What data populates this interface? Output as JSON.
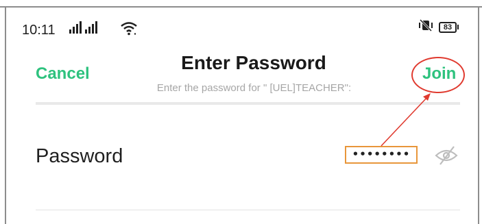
{
  "status_bar": {
    "time": "10:11",
    "battery_level": "83",
    "icons": [
      "signal-bars-icon",
      "signal-bars-icon",
      "wifi-icon",
      "vibrate-mute-icon",
      "battery-icon"
    ]
  },
  "header": {
    "cancel_label": "Cancel",
    "title": "Enter Password",
    "subtitle": "Enter the password for \" [UEL]TEACHER\":",
    "join_label": "Join"
  },
  "form": {
    "password_label": "Password",
    "password_value": "••••••••",
    "visibility_icon": "eye-off-icon"
  },
  "colors": {
    "accent": "#2ec27e",
    "annotation_red": "#e03a2f",
    "annotation_orange": "#e8963a",
    "subtitle_gray": "#a6a6a6"
  }
}
